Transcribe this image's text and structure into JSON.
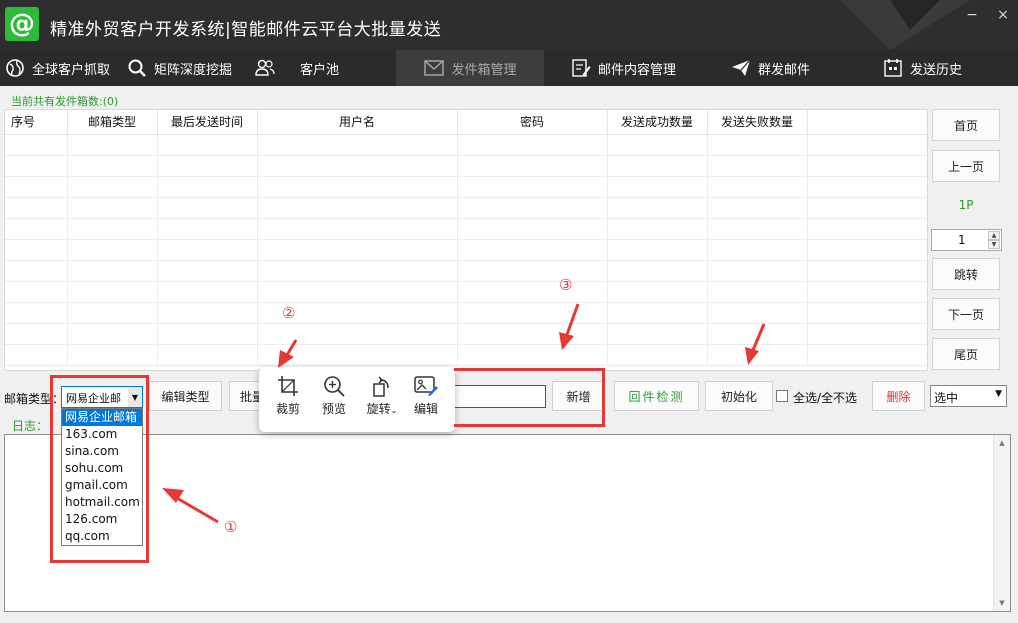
{
  "window": {
    "title": "精准外贸客户开发系统|智能邮件云平台大批量发送",
    "logo_glyph": "@",
    "minimize_glyph": "−",
    "close_glyph": "×"
  },
  "nav": {
    "items": [
      {
        "label": "全球客户抓取",
        "icon": "globe-icon"
      },
      {
        "label": "矩阵深度挖掘",
        "icon": "search-icon"
      },
      {
        "label": "客户池",
        "icon": "users-icon"
      },
      {
        "label": "发件箱管理",
        "icon": "mail-icon",
        "active": true
      },
      {
        "label": "邮件内容管理",
        "icon": "edit-doc-icon"
      },
      {
        "label": "群发邮件",
        "icon": "paper-plane-icon"
      },
      {
        "label": "发送历史",
        "icon": "calendar-icon"
      }
    ]
  },
  "mailbox_count_label": "当前共有发件箱数:(0)",
  "table": {
    "columns": [
      "序号",
      "邮箱类型",
      "最后发送时间",
      "用户名",
      "密码",
      "发送成功数量",
      "发送失败数量"
    ]
  },
  "pager": {
    "first": "首页",
    "prev": "上一页",
    "indicator": "1P",
    "page_value": "1",
    "jump": "跳转",
    "next": "下一页",
    "last": "尾页"
  },
  "toolbar": {
    "mailbox_type_label": "邮箱类型：",
    "mailbox_type_value": "网易企业邮",
    "edit_type": "编辑类型",
    "batch_partial": "批量",
    "add": "新增",
    "check": "回件检测",
    "init": "初始化",
    "select_all": "全选/全不选",
    "delete": "删除",
    "select_value": "选中"
  },
  "dropdown_options": [
    "网易企业邮箱",
    "163.com",
    "sina.com",
    "sohu.com",
    "gmail.com",
    "hotmail.com",
    "126.com",
    "qq.com"
  ],
  "log_label": "日志：",
  "image_toolbar": {
    "crop": "裁剪",
    "preview": "预览",
    "rotate": "旋转",
    "edit": "编辑"
  },
  "annotations": {
    "one": "①",
    "two": "②",
    "three": "③"
  },
  "colors": {
    "accent_green": "#2c9a2c",
    "annotation_red": "#e53935",
    "selection_blue": "#0078d7"
  }
}
